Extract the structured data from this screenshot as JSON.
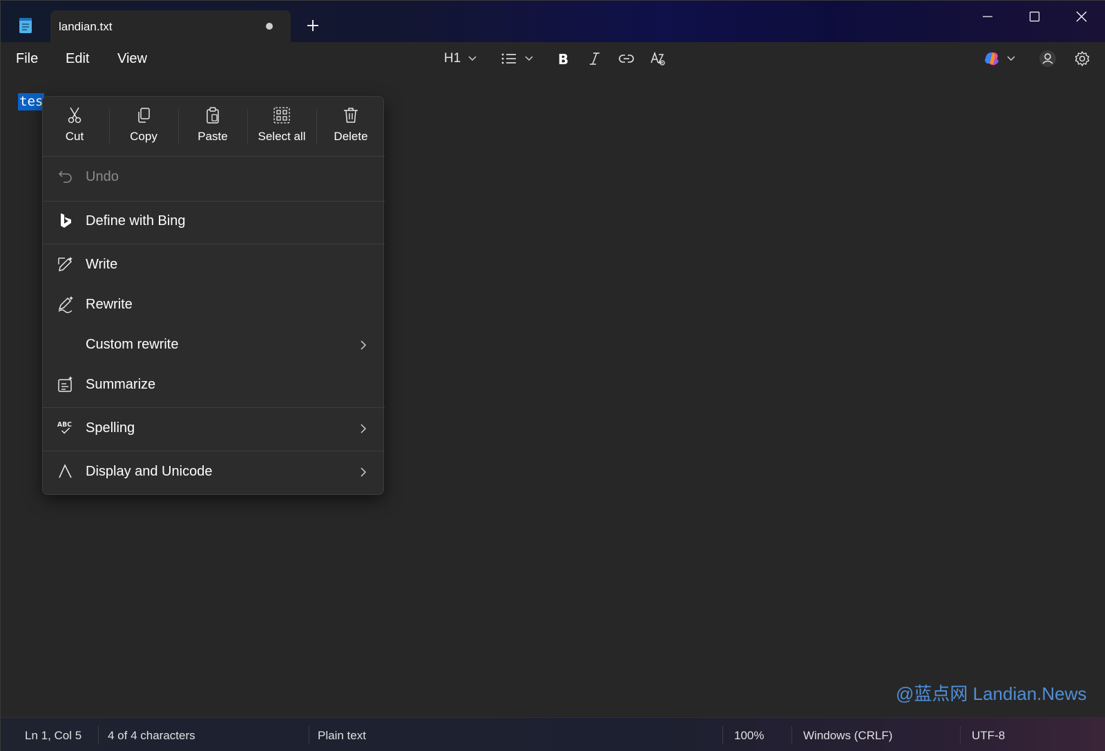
{
  "tab": {
    "title": "landian.txt"
  },
  "menu": {
    "file": "File",
    "edit": "Edit",
    "view": "View"
  },
  "toolbar": {
    "heading": "H1"
  },
  "editor": {
    "selected_text": "tes"
  },
  "context_menu": {
    "quick_actions": [
      {
        "label": "Cut",
        "icon": "scissors-icon"
      },
      {
        "label": "Copy",
        "icon": "copy-icon"
      },
      {
        "label": "Paste",
        "icon": "clipboard-icon"
      },
      {
        "label": "Select all",
        "icon": "select-all-icon"
      },
      {
        "label": "Delete",
        "icon": "trash-icon"
      }
    ],
    "items": [
      {
        "label": "Undo",
        "icon": "undo-icon",
        "enabled": false
      },
      {
        "label": "Define with Bing",
        "icon": "bing-icon",
        "enabled": true
      },
      {
        "label": "Write",
        "icon": "pencil-sparkle-icon",
        "enabled": true
      },
      {
        "label": "Rewrite",
        "icon": "pen-sparkle-icon",
        "enabled": true
      },
      {
        "label": "Custom rewrite",
        "icon": "",
        "enabled": true,
        "submenu": true
      },
      {
        "label": "Summarize",
        "icon": "summarize-icon",
        "enabled": true
      },
      {
        "label": "Spelling",
        "icon": "spelling-icon",
        "enabled": true,
        "submenu": true
      },
      {
        "label": "Display and Unicode",
        "icon": "unicode-icon",
        "enabled": true,
        "submenu": true
      }
    ]
  },
  "watermark": "@蓝点网 Landian.News",
  "status": {
    "position": "Ln 1, Col 5",
    "characters": "4 of 4 characters",
    "format": "Plain text",
    "zoom": "100%",
    "line_ending": "Windows (CRLF)",
    "encoding": "UTF-8"
  },
  "colors": {
    "selection": "#0a62c8",
    "menu_bg": "#2c2c2c",
    "editor_bg": "#272727"
  }
}
